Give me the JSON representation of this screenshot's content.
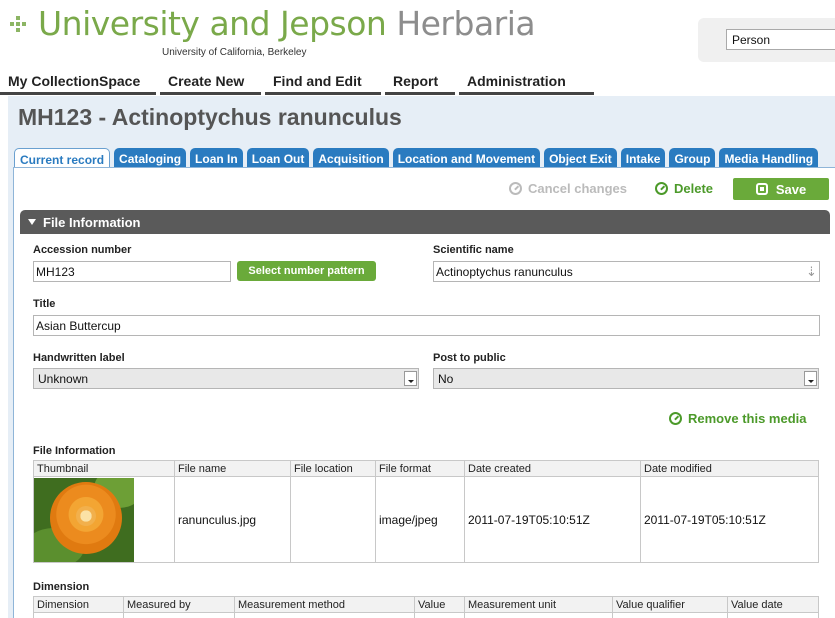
{
  "header": {
    "logo_part1": "University and Jepson",
    "logo_part2": "Herbaria",
    "logo_subtitle": "University of California, Berkeley",
    "search_type": "Person"
  },
  "nav": [
    "My CollectionSpace",
    "Create New",
    "Find and Edit",
    "Report",
    "Administration"
  ],
  "record": {
    "title": "MH123 - Actinoptychus ranunculus",
    "tabs": [
      "Current record",
      "Cataloging",
      "Loan In",
      "Loan Out",
      "Acquisition",
      "Location and Movement",
      "Object Exit",
      "Intake",
      "Group",
      "Media Handling"
    ],
    "active_tab": "Current record"
  },
  "actions": {
    "cancel": "Cancel changes",
    "delete": "Delete",
    "save": "Save"
  },
  "section": {
    "title": "File Information"
  },
  "form": {
    "accession_label": "Accession number",
    "accession_value": "MH123",
    "pattern_button": "Select number pattern",
    "sciname_label": "Scientific name",
    "sciname_value": "Actinoptychus ranunculus",
    "title_label": "Title",
    "title_value": "Asian Buttercup",
    "handwritten_label": "Handwritten label",
    "handwritten_value": "Unknown",
    "post_label": "Post to public",
    "post_value": "No",
    "remove_media": "Remove this media"
  },
  "file_info": {
    "heading": "File Information",
    "columns": [
      "Thumbnail",
      "File name",
      "File location",
      "File format",
      "Date created",
      "Date modified"
    ],
    "row": {
      "file_name": "ranunculus.jpg",
      "file_location": "",
      "file_format": "image/jpeg",
      "date_created": "2011-07-19T05:10:51Z",
      "date_modified": "2011-07-19T05:10:51Z"
    }
  },
  "dimension": {
    "heading": "Dimension",
    "columns": [
      "Dimension",
      "Measured by",
      "Measurement method",
      "Value",
      "Measurement unit",
      "Value qualifier",
      "Value date"
    ]
  },
  "colors": {
    "brand_green": "#7aa94a",
    "action_green": "#6aaa3a",
    "tab_blue": "#2a7bc0",
    "section_gray": "#5a5a5a"
  }
}
